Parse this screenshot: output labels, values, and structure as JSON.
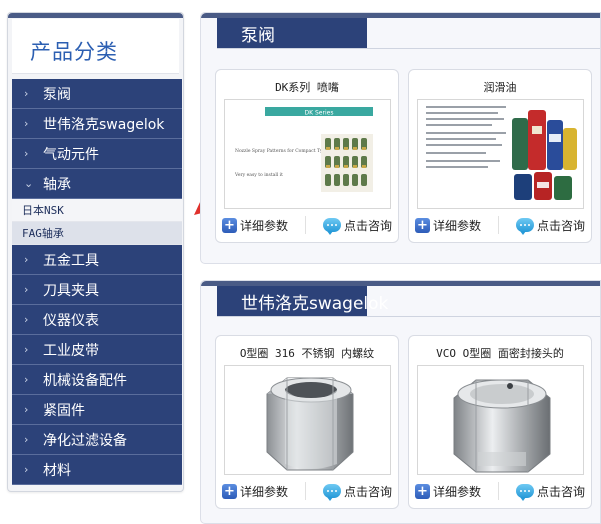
{
  "sidebar": {
    "title": "产品分类",
    "categories": [
      {
        "label": "泵阀",
        "expanded": false
      },
      {
        "label": "世伟洛克swagelok",
        "expanded": false
      },
      {
        "label": "气动元件",
        "expanded": false
      },
      {
        "label": "轴承",
        "expanded": true
      },
      {
        "label": "五金工具",
        "expanded": false
      },
      {
        "label": "刀具夹具",
        "expanded": false
      },
      {
        "label": "仪器仪表",
        "expanded": false
      },
      {
        "label": "工业皮带",
        "expanded": false
      },
      {
        "label": "机械设备配件",
        "expanded": false
      },
      {
        "label": "紧固件",
        "expanded": false
      },
      {
        "label": "净化过滤设备",
        "expanded": false
      },
      {
        "label": "材料",
        "expanded": false
      }
    ],
    "subitems": [
      {
        "label": "日本NSK",
        "active": false
      },
      {
        "label": "FAG轴承",
        "active": true
      }
    ]
  },
  "panels": [
    {
      "tab": "泵阀",
      "products": [
        {
          "title": "DK系列 喷嘴",
          "image": "nozzle-brochure",
          "banner": "DK Series",
          "text1": "Nozzle Spray Patterns for Compact Type Sprays",
          "text2": "Very easy to install it"
        },
        {
          "title": "润滑油",
          "image": "lubricant-cans"
        }
      ]
    },
    {
      "tab": "世伟洛克swagelok",
      "products": [
        {
          "title": "O型圈 316 不锈钢 内螺纹",
          "image": "hex-nut-fitting"
        },
        {
          "title": "VCO O型圈 面密封接头的",
          "image": "hex-cap-fitting"
        }
      ]
    }
  ],
  "actions": {
    "details": "详细参数",
    "consult": "点击咨询"
  },
  "colors": {
    "nav_bg": "#2c4279",
    "title_blue": "#2c5fb2",
    "arrow_red": "#e0312c"
  }
}
